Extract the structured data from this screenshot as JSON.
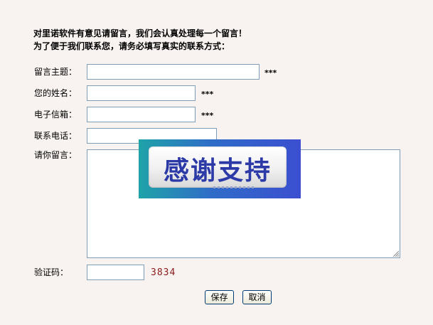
{
  "intro": {
    "line1": "对里诺软件有意见请留言，我们会认真处理每一个留言！",
    "line2": "为了便于我们联系您，请务必填写真实的联系方式："
  },
  "form": {
    "subject_label": "留言主题：",
    "name_label": "您的姓名：",
    "email_label": "电子信箱：",
    "phone_label": "联系电话：",
    "message_label": "请你留言：",
    "captcha_label": "验证码：",
    "required_mark": "***",
    "subject_value": "",
    "name_value": "",
    "email_value": "",
    "phone_value": "",
    "message_value": "",
    "captcha_value": ""
  },
  "captcha_code": "3834",
  "buttons": {
    "save": "保存",
    "cancel": "取消"
  },
  "banner": {
    "text": "感谢支持"
  },
  "colors": {
    "background": "#f8f3f0",
    "field_border": "#7e9db9",
    "captcha_text": "#8a1a1a",
    "banner_text": "#2c3aa8"
  }
}
